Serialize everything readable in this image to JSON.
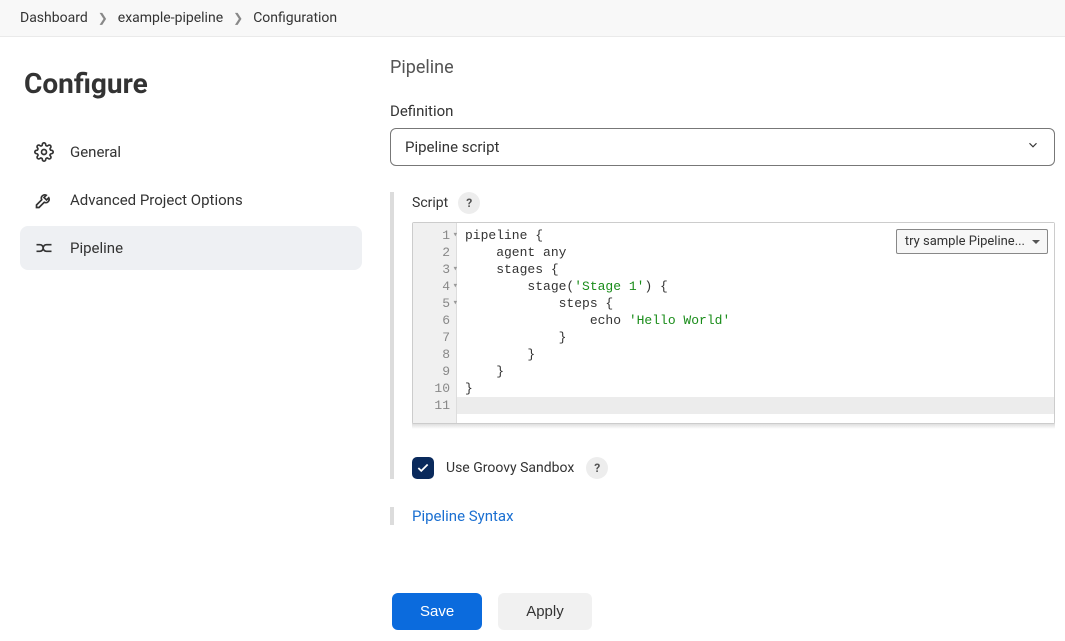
{
  "breadcrumb": {
    "items": [
      "Dashboard",
      "example-pipeline",
      "Configuration"
    ]
  },
  "sidebar": {
    "title": "Configure",
    "items": [
      {
        "label": "General",
        "icon": "gear"
      },
      {
        "label": "Advanced Project Options",
        "icon": "wrench"
      },
      {
        "label": "Pipeline",
        "icon": "pipeline"
      }
    ],
    "active_index": 2
  },
  "main": {
    "section_title": "Pipeline",
    "definition_label": "Definition",
    "definition_value": "Pipeline script",
    "script_label": "Script",
    "sample_select": "try sample Pipeline...",
    "sandbox_label": "Use Groovy Sandbox",
    "sandbox_checked": true,
    "syntax_link": "Pipeline Syntax",
    "help_badge": "?"
  },
  "editor": {
    "line_count": 11,
    "fold_lines": [
      1,
      3,
      4,
      5
    ],
    "current_line": 11,
    "code_lines": [
      "pipeline {",
      "    agent any",
      "    stages {",
      "        stage('Stage 1') {",
      "            steps {",
      "                echo 'Hello World'",
      "            }",
      "        }",
      "    }",
      "}",
      ""
    ],
    "string_tokens": [
      "'Stage 1'",
      "'Hello World'"
    ]
  },
  "footer": {
    "save": "Save",
    "apply": "Apply"
  }
}
